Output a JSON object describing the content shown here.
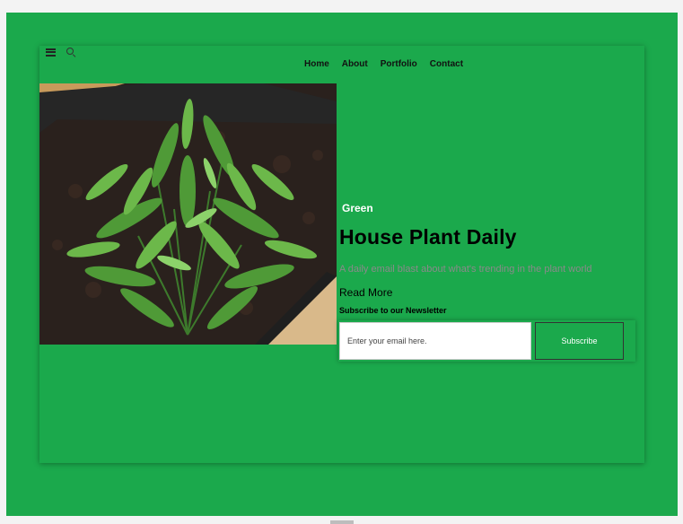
{
  "header": {
    "icons": [
      "menu-icon",
      "search-icon"
    ],
    "nav": [
      "Home",
      "About",
      "Portfolio",
      "Contact"
    ]
  },
  "hero": {
    "category": "Green",
    "title": "House Plant Daily",
    "description": "A daily email blast about what's trending in the plant world",
    "read_more": "Read More"
  },
  "newsletter": {
    "label": "Subscribe to our Newsletter",
    "email_placeholder": "Enter your email here.",
    "button_label": "Subscribe"
  },
  "colors": {
    "background": "#1ba94c",
    "title": "#000000",
    "category": "#ffffff",
    "description": "#8a8a8a"
  }
}
